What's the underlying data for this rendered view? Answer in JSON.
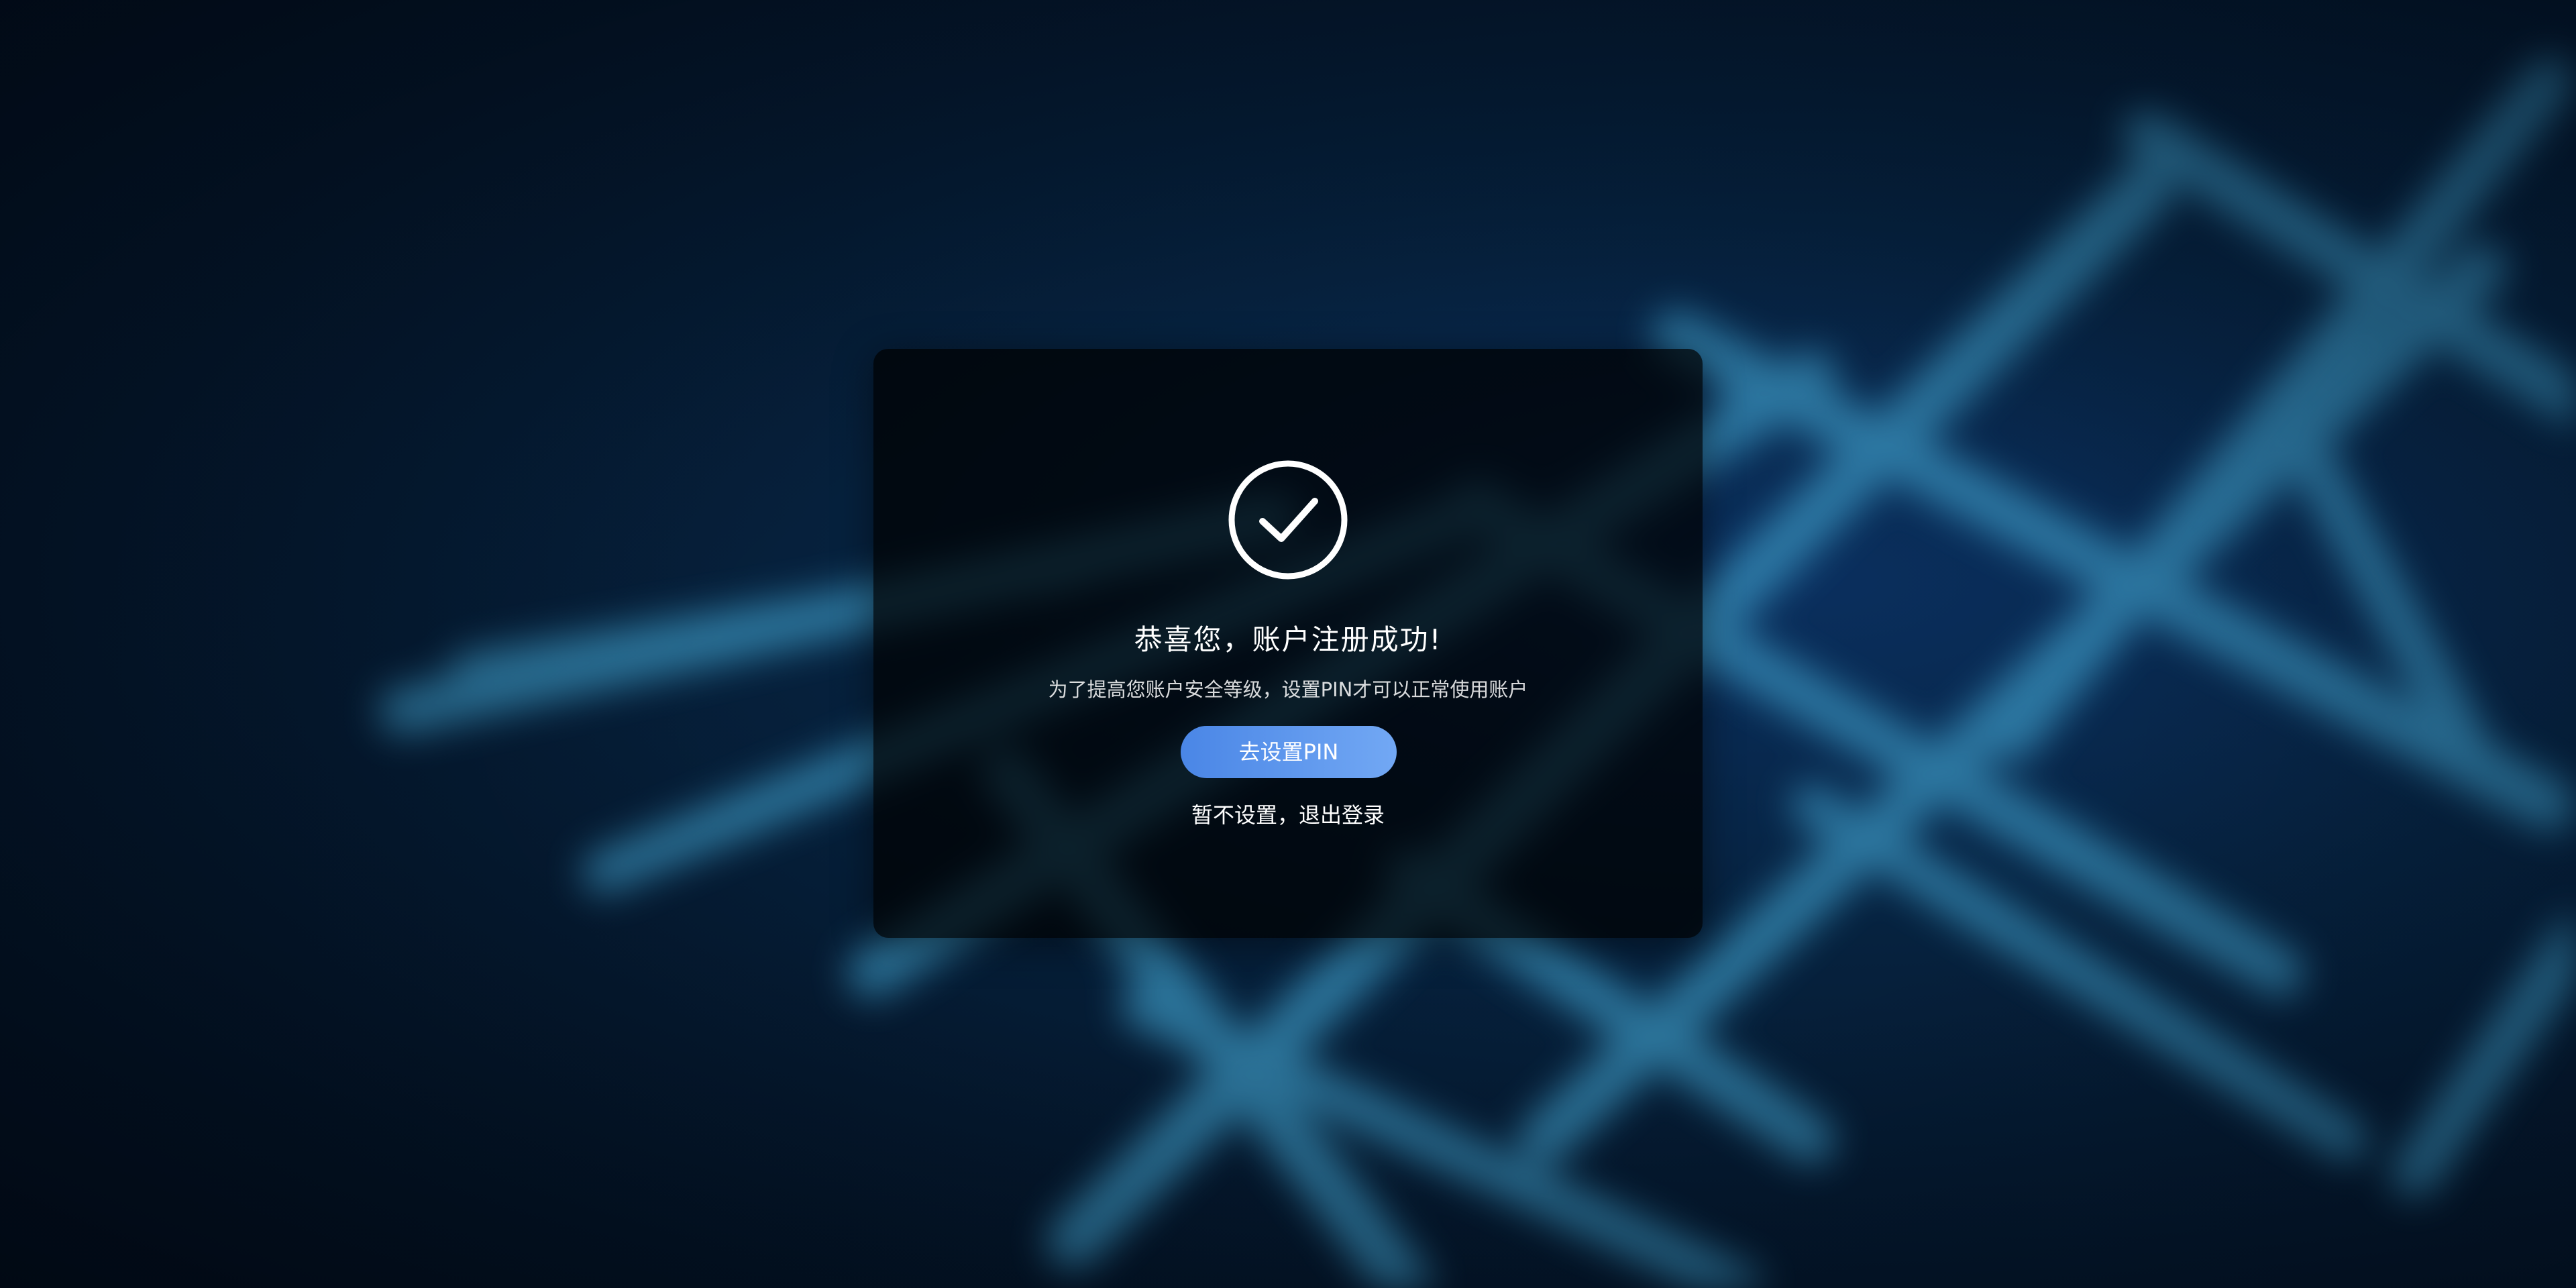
{
  "dialog": {
    "title": "恭喜您，账户注册成功!",
    "subtitle": "为了提高您账户安全等级，设置PIN才可以正常使用账户",
    "primary_button_label": "去设置PIN",
    "secondary_link_label": "暂不设置，退出登录",
    "icon": "checkmark-circle-icon"
  },
  "colors": {
    "accent_start": "#4a86e6",
    "accent_end": "#72a8f4",
    "background": "#041528"
  }
}
